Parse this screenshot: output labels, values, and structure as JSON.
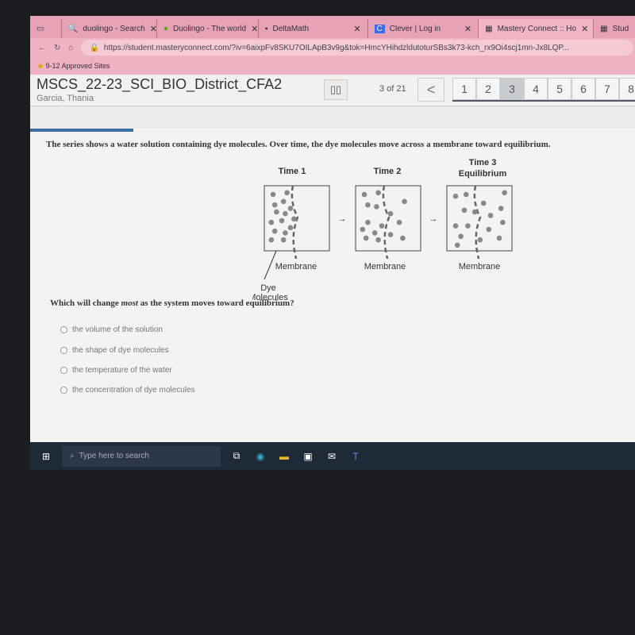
{
  "browser": {
    "tabs": [
      {
        "label": "duolingo - Search",
        "icon": "search-icon"
      },
      {
        "label": "Duolingo - The world",
        "icon": "duolingo-icon"
      },
      {
        "label": "DeltaMath",
        "icon": "deltamath-icon"
      },
      {
        "label": "Clever | Log in",
        "icon": "clever-icon"
      },
      {
        "label": "Mastery Connect :: Ho",
        "icon": "mastery-icon"
      },
      {
        "label": "Stud",
        "icon": "mastery-icon"
      }
    ],
    "url": "https://student.masteryconnect.com/?iv=6aixpFv8SKU7OILApB3v9g&tok=HmcYHihdzldutoturSBs3k73-kch_rx9Oi4scj1mn-Jx8LQP...",
    "bookmark": "9-12 Approved Sites"
  },
  "header": {
    "title": "MSCS_22-23_SCI_BIO_District_CFA2",
    "student": "Garcia, Thania",
    "pause": "▯▯",
    "count": "3 of 21",
    "prev": "<",
    "pages": [
      "1",
      "2",
      "3",
      "4",
      "5",
      "6",
      "7",
      "8"
    ],
    "current_page": "3"
  },
  "question": {
    "stem": "The series shows a water solution containing dye molecules. Over time, the dye molecules move across a membrane toward equilibrium.",
    "figure": {
      "time1": "Time 1",
      "time2": "Time 2",
      "time3a": "Time 3",
      "time3b": "Equilibrium",
      "membrane": "Membrane",
      "dye1": "Dye",
      "dye2": "Molecules"
    },
    "prompt_pre": "Which will change ",
    "prompt_em": "most",
    "prompt_post": " as the system moves toward equilibrium?",
    "options": [
      "the volume of the solution",
      "the shape of dye molecules",
      "the temperature of the water",
      "the concentration of dye molecules"
    ]
  },
  "taskbar": {
    "search_placeholder": "Type here to search"
  }
}
